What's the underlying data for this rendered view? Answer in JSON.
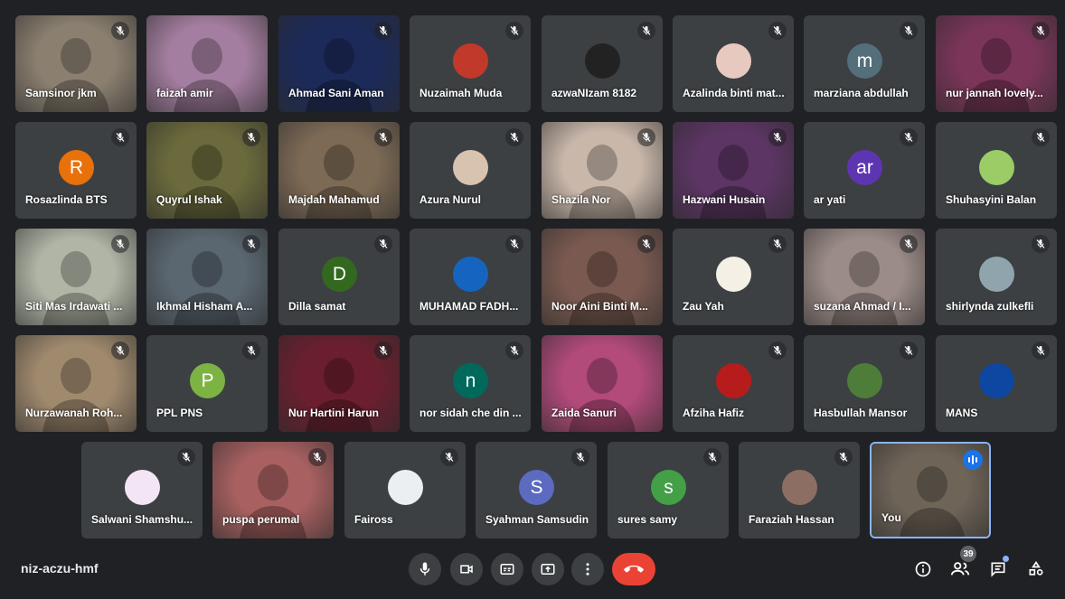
{
  "meeting": {
    "code": "niz-aczu-hmf",
    "participant_count": "39"
  },
  "colors": {
    "background": "#202124",
    "tile": "#3c4043",
    "hangup": "#ea4335",
    "accent": "#1a73e8"
  },
  "controls": [
    {
      "name": "microphone-button",
      "icon": "mic-icon"
    },
    {
      "name": "camera-button",
      "icon": "camera-icon"
    },
    {
      "name": "captions-button",
      "icon": "captions-icon"
    },
    {
      "name": "present-button",
      "icon": "present-icon"
    },
    {
      "name": "more-options-button",
      "icon": "more-vert-icon"
    },
    {
      "name": "hangup-button",
      "icon": "call-end-icon"
    }
  ],
  "right_controls": [
    {
      "name": "meeting-details-button",
      "icon": "info-icon"
    },
    {
      "name": "people-button",
      "icon": "people-icon"
    },
    {
      "name": "chat-button",
      "icon": "chat-icon"
    },
    {
      "name": "activities-button",
      "icon": "activities-icon"
    }
  ],
  "participants": [
    {
      "name": "Samsinor jkm",
      "video": true,
      "bg": "#8b8070",
      "muted": true
    },
    {
      "name": "faizah amir",
      "video": true,
      "bg": "#a47ea0",
      "muted": false
    },
    {
      "name": "Ahmad Sani Aman",
      "video": true,
      "bg": "#1c2a5a",
      "muted": true
    },
    {
      "name": "Nuzaimah Muda",
      "avatar_bg": "#c0392b",
      "avatar_text": "",
      "muted": true
    },
    {
      "name": "azwaNIzam 8182",
      "avatar_bg": "#222222",
      "avatar_text": "",
      "muted": true
    },
    {
      "name": "Azalinda binti mat...",
      "avatar_bg": "#e8c9c0",
      "avatar_text": "",
      "muted": true
    },
    {
      "name": "marziana abdullah",
      "avatar_bg": "#546e7a",
      "avatar_text": "m",
      "muted": true
    },
    {
      "name": "nur jannah lovely...",
      "video": true,
      "bg": "#7a3558",
      "muted": true
    },
    {
      "name": "Rosazlinda BTS",
      "avatar_bg": "#e8710a",
      "avatar_text": "R",
      "muted": true
    },
    {
      "name": "Quyrul Ishak",
      "video": true,
      "bg": "#6b6a3c",
      "muted": true
    },
    {
      "name": "Majdah Mahamud",
      "video": true,
      "bg": "#7d6a55",
      "muted": true
    },
    {
      "name": "Azura Nurul",
      "avatar_bg": "#d8c3b0",
      "avatar_text": "",
      "muted": true
    },
    {
      "name": "Shazila Nor",
      "video": true,
      "bg": "#c9b7aa",
      "muted": true
    },
    {
      "name": "Hazwani Husain",
      "video": true,
      "bg": "#5c3564",
      "muted": true
    },
    {
      "name": "ar yati",
      "avatar_bg": "#5e35b1",
      "avatar_text": "ar",
      "muted": true
    },
    {
      "name": "Shuhasyini Balan",
      "avatar_bg": "#9ccc65",
      "avatar_text": "",
      "muted": true
    },
    {
      "name": "Siti Mas Irdawati ...",
      "video": true,
      "bg": "#b0b5a6",
      "muted": true
    },
    {
      "name": "Ikhmal Hisham A...",
      "video": true,
      "bg": "#5a6670",
      "muted": true
    },
    {
      "name": "Dilla samat",
      "avatar_bg": "#33691e",
      "avatar_text": "D",
      "muted": true
    },
    {
      "name": "MUHAMAD FADH...",
      "avatar_bg": "#1565c0",
      "avatar_text": "",
      "muted": true
    },
    {
      "name": "Noor Aini Binti M...",
      "video": true,
      "bg": "#7a5a50",
      "muted": true
    },
    {
      "name": "Zau Yah",
      "avatar_bg": "#f5f0e6",
      "avatar_text": "",
      "muted": true
    },
    {
      "name": "suzana Ahmad / I...",
      "video": true,
      "bg": "#9c8c88",
      "muted": true
    },
    {
      "name": "shirlynda zulkefli",
      "avatar_bg": "#90a4ae",
      "avatar_text": "",
      "muted": true
    },
    {
      "name": "Nurzawanah Roh...",
      "video": true,
      "bg": "#a08a6e",
      "muted": true
    },
    {
      "name": "PPL PNS",
      "avatar_bg": "#7cb342",
      "avatar_text": "P",
      "muted": true
    },
    {
      "name": "Nur Hartini Harun",
      "video": true,
      "bg": "#6b1f2e",
      "muted": true
    },
    {
      "name": "nor sidah che din ...",
      "avatar_bg": "#00695c",
      "avatar_text": "n",
      "muted": true
    },
    {
      "name": "Zaida Sanuri",
      "video": true,
      "bg": "#b24a7a",
      "muted": false
    },
    {
      "name": "Afziha Hafiz",
      "avatar_bg": "#b71c1c",
      "avatar_text": "",
      "muted": true
    },
    {
      "name": "Hasbullah Mansor",
      "avatar_bg": "#4e7d3a",
      "avatar_text": "",
      "muted": true
    },
    {
      "name": "MANS",
      "avatar_bg": "#0d47a1",
      "avatar_text": "",
      "muted": true
    },
    {
      "name": "Salwani Shamshu...",
      "avatar_bg": "#f3e5f5",
      "avatar_text": "",
      "muted": true
    },
    {
      "name": "puspa perumal",
      "video": true,
      "bg": "#a86060",
      "muted": true
    },
    {
      "name": "Faiross",
      "avatar_bg": "#eceff1",
      "avatar_text": "",
      "muted": true
    },
    {
      "name": "Syahman Samsudin",
      "avatar_bg": "#5c6bc0",
      "avatar_text": "S",
      "muted": true
    },
    {
      "name": "sures samy",
      "avatar_bg": "#43a047",
      "avatar_text": "s",
      "muted": true
    },
    {
      "name": "Faraziah Hassan",
      "avatar_bg": "#8d6e63",
      "avatar_text": "",
      "muted": true
    },
    {
      "name": "You",
      "video": true,
      "bg": "#6e6458",
      "muted": false,
      "self": true
    }
  ]
}
